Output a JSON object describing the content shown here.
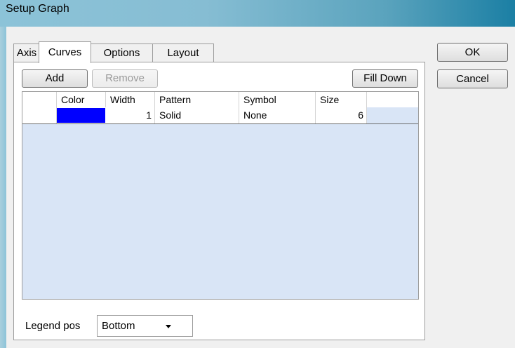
{
  "window": {
    "title": "Setup Graph"
  },
  "tabs": [
    {
      "label": "Axis"
    },
    {
      "label": "Curves"
    },
    {
      "label": "Options"
    },
    {
      "label": "Layout"
    }
  ],
  "actions": {
    "ok": "OK",
    "cancel": "Cancel"
  },
  "toolbar": {
    "add": "Add",
    "remove": "Remove",
    "fill_down": "Fill Down"
  },
  "grid": {
    "headers": [
      "",
      "Color",
      "Width",
      "Pattern",
      "Symbol",
      "Size",
      ""
    ],
    "rows": [
      {
        "color": "#0000ff",
        "width": "1",
        "pattern": "Solid",
        "symbol": "None",
        "size": "6"
      }
    ]
  },
  "legend": {
    "label": "Legend pos",
    "value": "Bottom"
  },
  "colors": {
    "selection": "#0000ff",
    "grid_background": "#d9e5f6"
  }
}
